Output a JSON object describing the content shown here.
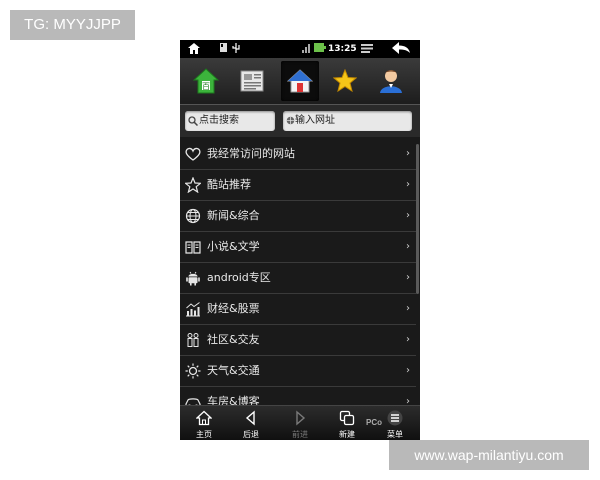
{
  "watermarks": {
    "top_left": "TG: MYYJJPP",
    "bottom_right": "www.wap-milantiyu.com"
  },
  "status_bar": {
    "time": "13:25"
  },
  "top_tabs": [
    {
      "icon": "baidu-home-icon"
    },
    {
      "icon": "news-icon"
    },
    {
      "icon": "home-icon",
      "active": true
    },
    {
      "icon": "favorite-star-icon"
    },
    {
      "icon": "user-icon"
    }
  ],
  "search": {
    "search_placeholder": "点击搜索",
    "url_placeholder": "输入网址"
  },
  "menu": {
    "items": [
      {
        "label": "我经常访问的网站",
        "icon": "heart-icon"
      },
      {
        "label": "酷站推荐",
        "icon": "star-outline-icon"
      },
      {
        "label": "新闻&综合",
        "icon": "globe-icon"
      },
      {
        "label": "小说&文学",
        "icon": "book-icon"
      },
      {
        "label": "android专区",
        "icon": "android-icon"
      },
      {
        "label": "财经&股票",
        "icon": "chart-icon"
      },
      {
        "label": "社区&交友",
        "icon": "people-icon"
      },
      {
        "label": "天气&交通",
        "icon": "sun-icon"
      },
      {
        "label": "车房&博客",
        "icon": "car-icon"
      }
    ],
    "chevron": "›"
  },
  "bottom_bar": {
    "home": "主页",
    "back": "后退",
    "forward": "前进",
    "new": "新建",
    "menu": "菜单"
  },
  "overlay_logo": "PCo",
  "colors": {
    "background": "#1a1a1a",
    "status_bar": "#000000",
    "text": "#eaeaea",
    "watermark": "#b9b9b9"
  }
}
